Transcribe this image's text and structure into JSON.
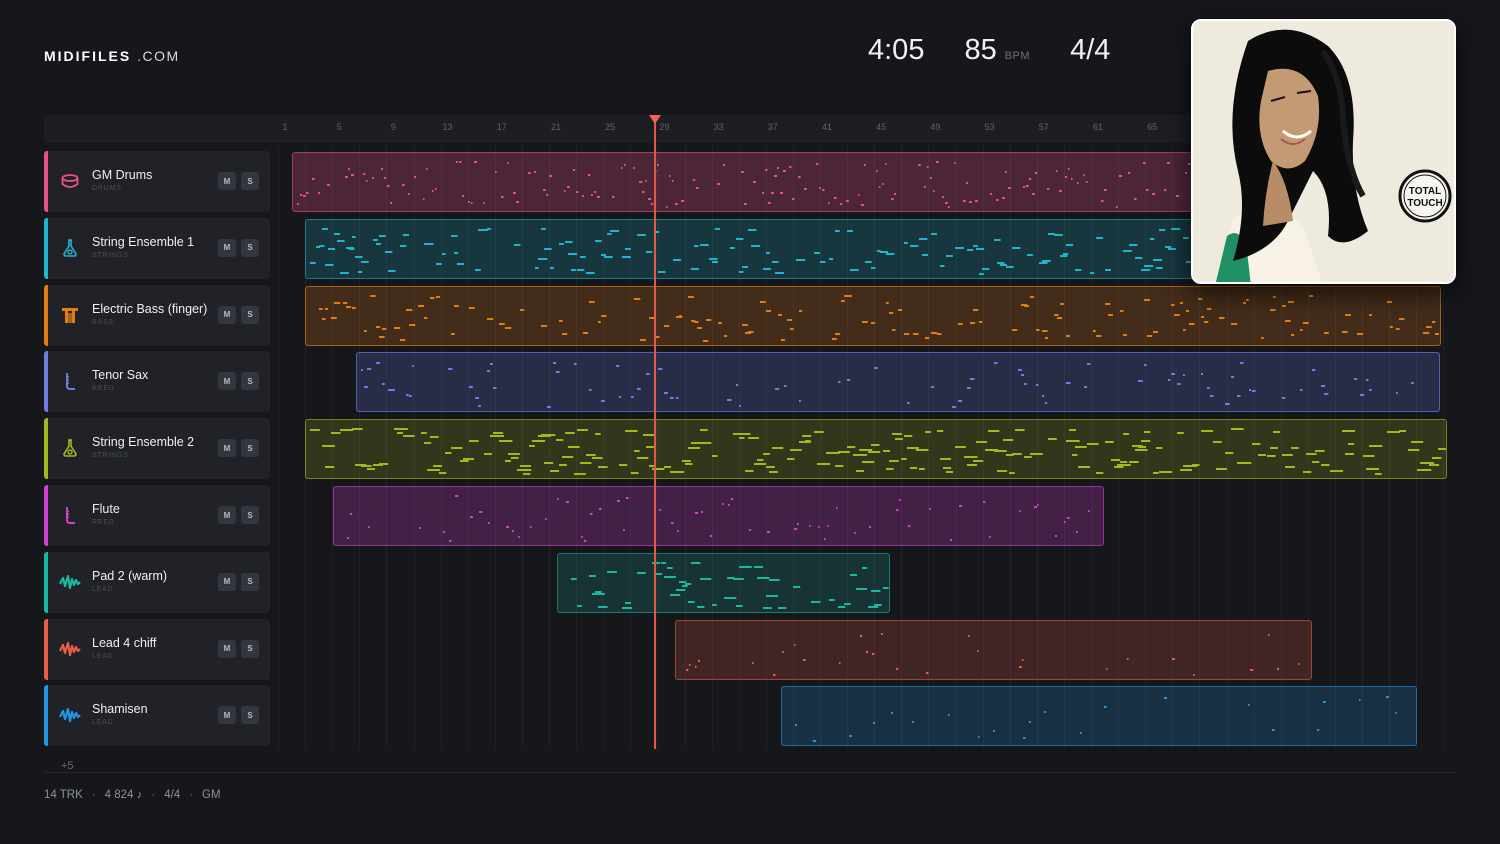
{
  "brand": {
    "name_bold": "MIDIFILES",
    "name_rest": ".COM"
  },
  "header": {
    "duration": "4:05",
    "tempo": "85",
    "tempo_unit": "BPM",
    "time_signature": "4/4"
  },
  "album_art": {
    "logo_line1": "TOTAL",
    "logo_line2": "TOUCH"
  },
  "ruler": {
    "ticks": [
      "1",
      "5",
      "9",
      "13",
      "17",
      "21",
      "25",
      "29",
      "33",
      "37",
      "41",
      "45",
      "49",
      "53",
      "57",
      "61",
      "65"
    ]
  },
  "tracks": [
    {
      "name": "GM Drums",
      "category": "DRUMS",
      "color": "#e8508a",
      "icon": "drum-icon",
      "mute": "M",
      "solo": "S"
    },
    {
      "name": "String Ensemble 1",
      "category": "STRINGS",
      "color": "#1fb5cf",
      "icon": "flask-icon",
      "mute": "M",
      "solo": "S"
    },
    {
      "name": "Electric Bass (finger)",
      "category": "BASS",
      "color": "#e27d12",
      "icon": "bass-icon",
      "mute": "M",
      "solo": "S"
    },
    {
      "name": "Tenor Sax",
      "category": "REED",
      "color": "#6f7de0",
      "icon": "reed-icon",
      "mute": "M",
      "solo": "S"
    },
    {
      "name": "String Ensemble 2",
      "category": "STRINGS",
      "color": "#a3b81d",
      "icon": "flask-icon",
      "mute": "M",
      "solo": "S"
    },
    {
      "name": "Flute",
      "category": "REED",
      "color": "#d43fd0",
      "icon": "reed-icon",
      "mute": "M",
      "solo": "S"
    },
    {
      "name": "Pad 2 (warm)",
      "category": "LEAD",
      "color": "#19b8a0",
      "icon": "wave-icon",
      "mute": "M",
      "solo": "S"
    },
    {
      "name": "Lead 4 chiff",
      "category": "LEAD",
      "color": "#ea5e4a",
      "icon": "wave-icon",
      "mute": "M",
      "solo": "S"
    },
    {
      "name": "Shamisen",
      "category": "LEAD",
      "color": "#1f96e6",
      "icon": "wave-icon",
      "mute": "M",
      "solo": "S"
    }
  ],
  "more_tracks": "+5",
  "footer": {
    "tracks": "14 TRK",
    "notes": "4 824 ♪",
    "meter": "4/4",
    "standard": "GM",
    "separator": "·"
  }
}
